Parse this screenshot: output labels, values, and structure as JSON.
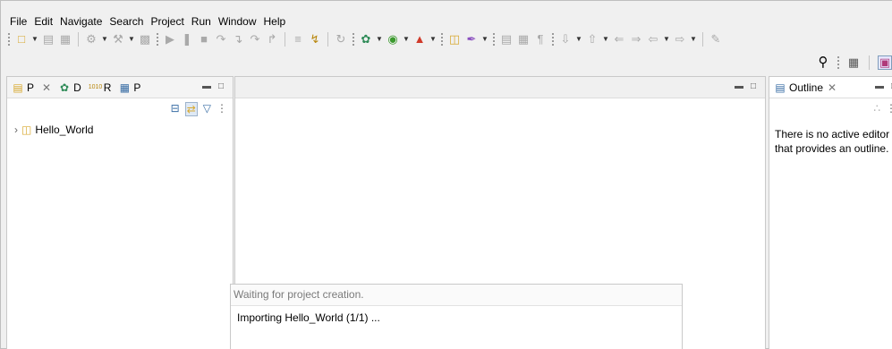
{
  "menu": [
    "File",
    "Edit",
    "Navigate",
    "Search",
    "Project",
    "Run",
    "Window",
    "Help"
  ],
  "left_panel": {
    "tabs": [
      {
        "icon": "package-explorer-icon",
        "label": "P"
      },
      {
        "icon": "debug-icon",
        "label": "D"
      },
      {
        "icon": "registers-icon",
        "label": "R"
      },
      {
        "icon": "project-explorer-icon",
        "label": "P"
      }
    ],
    "tree_item": "Hello_World"
  },
  "right_panel": {
    "tab_label": "Outline",
    "message": "There is no active editor that provides an outline."
  },
  "progress": {
    "header": "Waiting for project creation.",
    "task": "Importing Hello_World (1/1) ..."
  },
  "colors": {
    "accent_green": "#3c9a2e",
    "debug_green": "#2e8b57",
    "folder_yellow": "#d8a930",
    "red": "#d03a2a"
  }
}
